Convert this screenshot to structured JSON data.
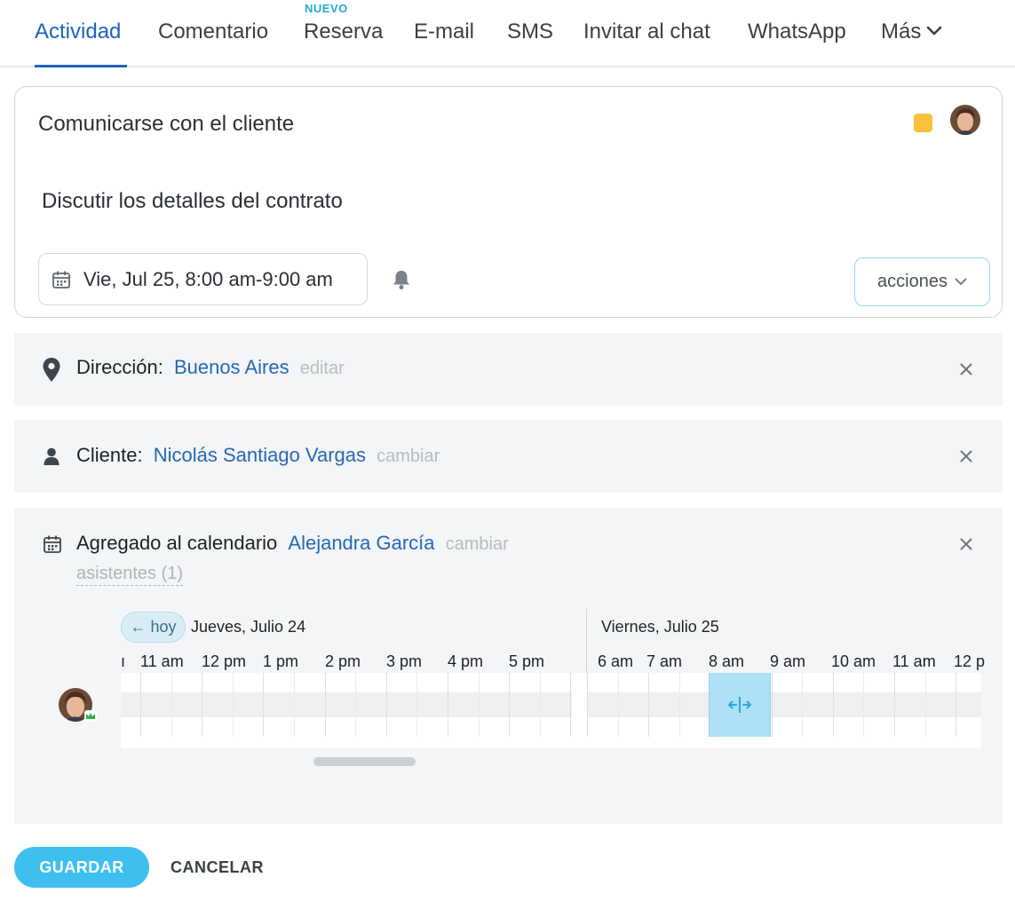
{
  "tabs": {
    "items": [
      {
        "label": "Actividad",
        "active": true
      },
      {
        "label": "Comentario"
      },
      {
        "label": "Reserva",
        "badge": "NUEVO"
      },
      {
        "label": "E-mail"
      },
      {
        "label": "SMS"
      },
      {
        "label": "Invitar al chat"
      },
      {
        "label": "WhatsApp"
      },
      {
        "label": "Más"
      }
    ],
    "more_icon": "chevron-down-icon"
  },
  "activity": {
    "title": "Comunicarse con el cliente",
    "color": "#f8c23a",
    "description": "Discutir los detalles del contrato",
    "datetime": "Vie, Jul 25, 8:00 am-9:00 am",
    "actions_label": "acciones"
  },
  "address": {
    "label": "Dirección:",
    "value": "Buenos Aires",
    "action": "editar"
  },
  "client": {
    "label": "Cliente:",
    "value": "Nicolás Santiago Vargas",
    "action": "cambiar"
  },
  "calendar": {
    "label": "Agregado al calendario",
    "owner": "Alejandra García",
    "action": "cambiar",
    "attendees": "asistentes (1)",
    "today_button": "← hoy",
    "days": [
      "Jueves, Julio 24",
      "Viernes, Julio 25"
    ],
    "hours_day1": [
      "11 am",
      "12 pm",
      "1 pm",
      "2 pm",
      "3 pm",
      "4 pm",
      "5 pm"
    ],
    "hours_day2": [
      "6 am",
      "7 am",
      "8 am",
      "9 am",
      "10 am",
      "11 am",
      "12 p"
    ]
  },
  "footer": {
    "save": "GUARDAR",
    "cancel": "CANCELAR"
  },
  "colors": {
    "accent": "#1d63bf",
    "link": "#2568b4",
    "primary_button": "#3ec0ef",
    "event_block": "#aee1f5"
  }
}
